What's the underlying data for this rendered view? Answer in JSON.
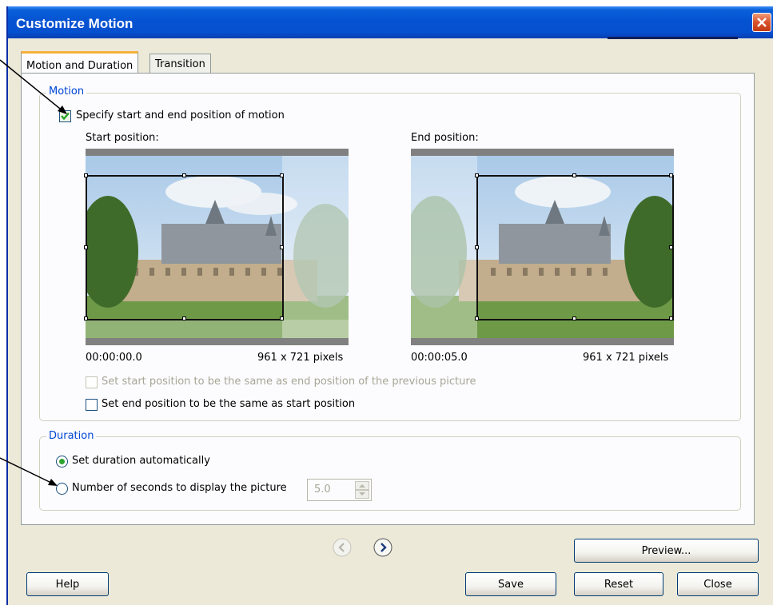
{
  "window": {
    "title": "Customize Motion"
  },
  "tabs": [
    {
      "label": "Motion and Duration",
      "active": true
    },
    {
      "label": "Transition",
      "active": false
    }
  ],
  "motion": {
    "legend": "Motion",
    "specify_checkbox": {
      "label": "Specify start and end position of motion",
      "checked": true
    },
    "start": {
      "label": "Start position:",
      "time": "00:00:00.0",
      "size": "961 x 721 pixels"
    },
    "end": {
      "label": "End position:",
      "time": "00:00:05.0",
      "size": "961 x 721 pixels"
    },
    "same_as_prev_checkbox": {
      "label": "Set start position to be the same as end position of the previous picture",
      "checked": false,
      "disabled": true
    },
    "same_as_start_checkbox": {
      "label": "Set end position to be the same as start position",
      "checked": false
    }
  },
  "duration": {
    "legend": "Duration",
    "auto_radio": {
      "label": "Set duration automatically",
      "selected": true
    },
    "seconds_radio": {
      "label": "Number of seconds to display the picture",
      "selected": false
    },
    "seconds_value": "5.0"
  },
  "buttons": {
    "preview": "Preview...",
    "help": "Help",
    "save": "Save",
    "reset": "Reset",
    "close": "Close"
  },
  "colors": {
    "title_bar": "#0553d2",
    "accent_link": "#0046d5",
    "dialog_bg": "#ece9d8"
  }
}
